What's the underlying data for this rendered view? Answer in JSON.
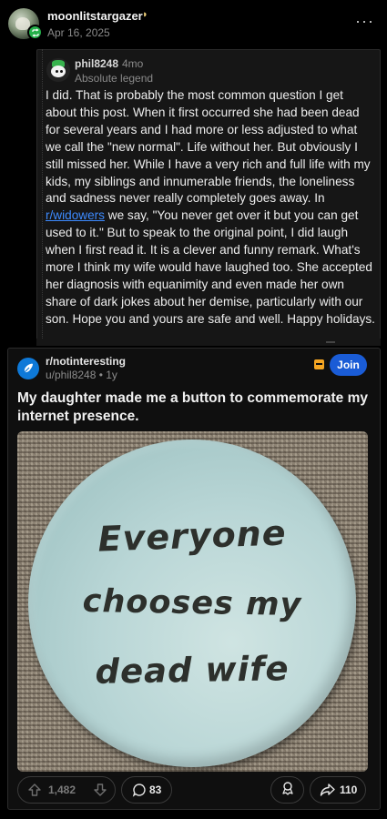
{
  "header": {
    "username": "moonlitstargazer",
    "date": "Apr 16, 2025",
    "more_label": "···"
  },
  "comment": {
    "username": "phil8248",
    "age": "4mo",
    "flair": "Absolute legend",
    "text_before_link": "I did.  That is probably the most common question I get about this post.  When it first occurred she had been dead for several years and I had more or less adjusted to what we call the \"new normal\".  Life without her. But obviously I still missed her.  While I have a very rich and full life with my kids, my siblings and innumerable friends, the loneliness and sadness never really completely goes away. In ",
    "link_text": "r/widowers",
    "text_after_link": " we say, \"You never get over it but you can get used to it.\"  But to speak to the original point, I did laugh when I first read it.  It is a clever and funny remark.  What's more I think my wife would have laughed too.  She accepted her diagnosis with equanimity and even made her own share of dark jokes about her demise, particularly with our son.  Hope you and yours are safe and well.  Happy holidays."
  },
  "post": {
    "subreddit": "r/notinteresting",
    "meta": "u/phil8248 • 1y",
    "join_label": "Join",
    "title": "My daughter made me a button to commemorate my internet presence.",
    "image_text": [
      "Everyone",
      "chooses my",
      "dead wife"
    ],
    "upvotes": "1,482",
    "comments": "83",
    "shares": "110"
  },
  "icons": {
    "repost": "repost-icon",
    "mod": "mod-shield-icon",
    "upvote": "upvote-icon",
    "downvote": "downvote-icon",
    "comment": "comment-icon",
    "award": "award-icon",
    "share": "share-icon"
  },
  "colors": {
    "background": "#000000",
    "card": "#161616",
    "join_button": "#1a5cd6",
    "link": "#3d8bff",
    "repost_badge": "#25b04a",
    "subreddit_icon": "#0e79d8"
  }
}
